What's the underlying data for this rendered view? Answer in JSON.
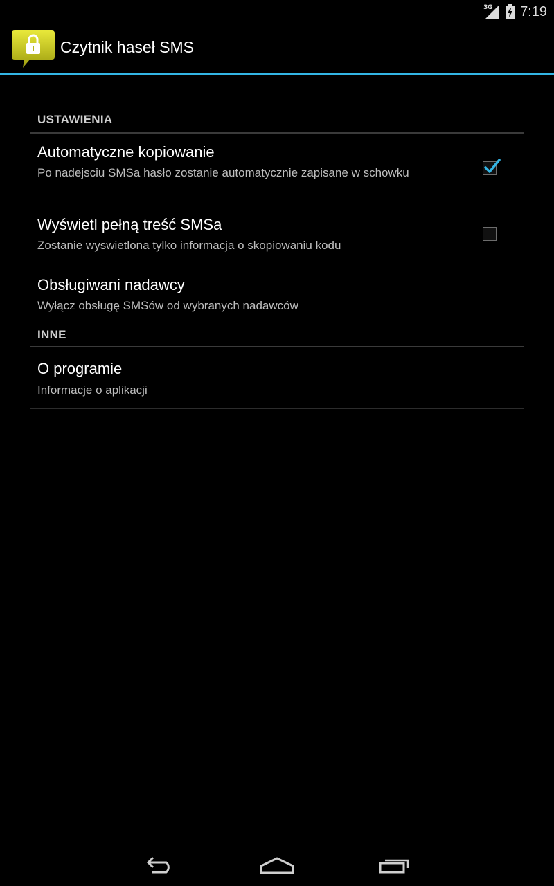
{
  "status_bar": {
    "network_type": "3G",
    "time": "7:19",
    "icons": [
      "signal-icon",
      "battery-charging-icon"
    ]
  },
  "action_bar": {
    "title": "Czytnik haseł SMS",
    "icon": "lock-message-icon",
    "accent_color": "#33b5e5",
    "icon_color": "#c8c81e"
  },
  "settings": {
    "categories": [
      {
        "label": "USTAWIENIA",
        "items": [
          {
            "title": "Automatyczne kopiowanie",
            "summary": "Po nadejsciu SMSa hasło zostanie automatycznie zapisane w schowku",
            "checkbox": true,
            "checked": true
          },
          {
            "title": "Wyświetl pełną treść SMSa",
            "summary": "Zostanie wyswietlona tylko informacja o skopiowaniu kodu",
            "checkbox": true,
            "checked": false
          },
          {
            "title": "Obsługiwani nadawcy",
            "summary": "Wyłącz obsługę SMSów od wybranych nadawców",
            "checkbox": false
          }
        ]
      },
      {
        "label": "INNE",
        "items": [
          {
            "title": "O programie",
            "summary": "Informacje o aplikacji",
            "checkbox": false
          }
        ]
      }
    ]
  },
  "nav_bar": {
    "icons": [
      "back-icon",
      "home-icon",
      "recent-apps-icon"
    ]
  }
}
